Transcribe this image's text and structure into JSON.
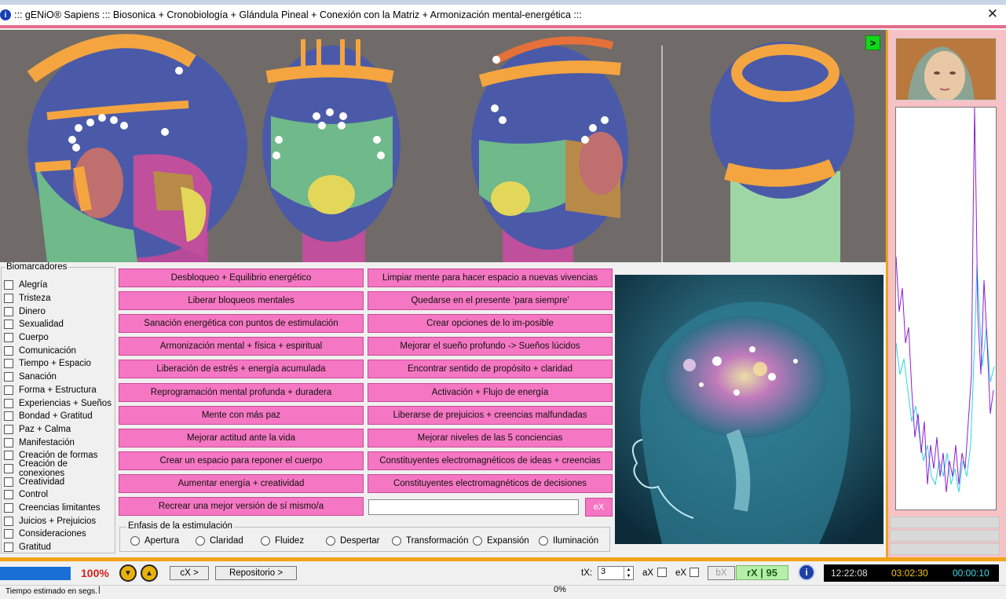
{
  "window": {
    "title": "::: gENiO® Sapiens ::: Biosonica + Cronobiología + Glándula Pineal + Conexión con la Matriz + Armonización mental-energética :::",
    "close": "✕",
    "go_button": ">"
  },
  "biomarcadores": {
    "legend": "Biomarcadores",
    "items": [
      "Alegría",
      "Tristeza",
      "Dinero",
      "Sexualidad",
      "Cuerpo",
      "Comunicación",
      "Tiempo + Espacio",
      "Sanación",
      "Forma + Estructura",
      "Experiencias + Sueños",
      "Bondad + Gratitud",
      "Paz + Calma",
      "Manifestación",
      "Creación de formas",
      "Creación de conexiones",
      "Creatividad",
      "Control",
      "Creencias limitantes",
      "Juicios + Prejuicios",
      "Consideraciones",
      "Gratitud"
    ]
  },
  "programs": {
    "left": [
      "Desbloqueo + Equilibrio energético",
      "Liberar bloqueos mentales",
      "Sanación energética con puntos de estimulación",
      "Armonización mental + física + espiritual",
      "Liberación de estrés + energía acumulada",
      "Reprogramación mental profunda + duradera",
      "Mente con más paz",
      "Mejorar actitud ante la vida",
      "Crear un espacio para reponer el cuerpo",
      "Aumentar energía + creatividad",
      "Recrear una mejor versión de sí mismo/a"
    ],
    "right": [
      "Limpiar mente para hacer espacio a nuevas vivencias",
      "Quedarse en el presente 'para siempre'",
      "Crear opciones de lo im-posible",
      "Mejorar el sueño profundo -> Sueños lúcidos",
      "Encontrar sentido de propósito + claridad",
      "Activación + Flujo de energía",
      "Liberarse de prejuicios + creencias malfundadas",
      "Mejorar niveles de las 5 conciencias",
      "Constituyentes electromagnéticos de ideas + creencias",
      "Constituyentes electromagnéticos de decisiones"
    ],
    "custom_value": "",
    "ex_button": "eX"
  },
  "enfasis": {
    "legend": "Enfasis de la estimulación",
    "options": [
      "Apertura",
      "Claridad",
      "Fluidez",
      "Despertar",
      "Transformación",
      "Expansión",
      "Iluminación"
    ]
  },
  "bottom": {
    "percent": "100%",
    "cx_button": "cX >",
    "repositorio_button": "Repositorio >",
    "tx_label": "tX:",
    "tx_value": "3",
    "ax_label": "aX",
    "ex_label": "eX",
    "bx_button": "bX",
    "rx_value": "rX | 95",
    "info": "i",
    "clock1": "12:22:08",
    "clock2": "03:02:30",
    "clock3": "00:00:10",
    "status_text": "Tiempo estimado en segs.",
    "status_pct": "0%"
  },
  "colors": {
    "pink_button": "#f577c3",
    "accent_orange": "#f2a316",
    "progress_blue": "#1a6fd6",
    "rx_green": "#b6f0a8",
    "clock_yellow": "#f5c518",
    "clock_cyan": "#3fd8e8"
  }
}
